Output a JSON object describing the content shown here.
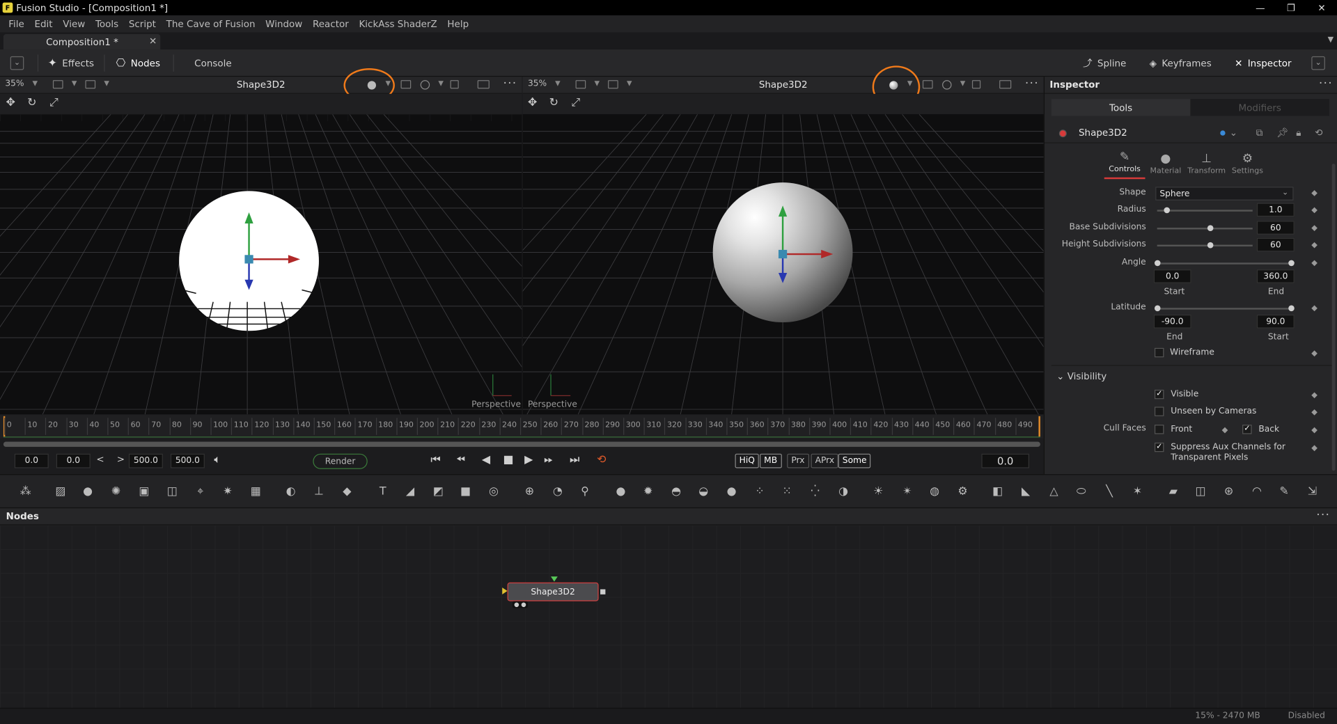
{
  "window": {
    "title": "Fusion Studio - [Composition1 *]",
    "controls": [
      "—",
      "❐",
      "✕"
    ]
  },
  "menu": [
    "File",
    "Edit",
    "View",
    "Tools",
    "Script",
    "The Cave of Fusion",
    "Window",
    "Reactor",
    "KickAss ShaderZ",
    "Help"
  ],
  "doc_tab": {
    "label": "Composition1 *",
    "close": "✕"
  },
  "toolbar": {
    "effects": "Effects",
    "nodes": "Nodes",
    "console": "Console",
    "spline": "Spline",
    "keyframes": "Keyframes",
    "inspector": "Inspector"
  },
  "viewer_left": {
    "zoom": "35%",
    "title": "Shape3D2",
    "label": "Perspective"
  },
  "viewer_right": {
    "zoom": "35%",
    "title": "Shape3D2",
    "label": "Perspective"
  },
  "ruler": {
    "ticks": [
      "0",
      "10",
      "20",
      "30",
      "40",
      "50",
      "60",
      "70",
      "80",
      "90",
      "100",
      "110",
      "120",
      "130",
      "140",
      "150",
      "160",
      "170",
      "180",
      "190",
      "200",
      "210",
      "220",
      "230",
      "240",
      "250",
      "260",
      "270",
      "280",
      "290",
      "300",
      "310",
      "320",
      "330",
      "340",
      "350",
      "360",
      "370",
      "380",
      "390",
      "400",
      "410",
      "420",
      "430",
      "440",
      "450",
      "460",
      "470",
      "480",
      "490"
    ]
  },
  "transport": {
    "global_start": "0.0",
    "render_start": "0.0",
    "render_end": "500.0",
    "global_end": "500.0",
    "render_label": "Render",
    "toggles": [
      "HiQ",
      "MB",
      "Prx",
      "APrx",
      "Some"
    ],
    "current_time": "0.0"
  },
  "nodes_panel": {
    "title": "Nodes",
    "node_label": "Shape3D2"
  },
  "status": {
    "memory": "15% - 2470 MB",
    "state": "Disabled"
  },
  "inspector": {
    "title": "Inspector",
    "seg_tools": "Tools",
    "seg_modifiers": "Modifiers",
    "tool_name": "Shape3D2",
    "subtabs": [
      "Controls",
      "Material",
      "Transform",
      "Settings"
    ],
    "shape_label": "Shape",
    "shape_value": "Sphere",
    "radius_label": "Radius",
    "radius_value": "1.0",
    "base_sub_label": "Base Subdivisions",
    "base_sub_value": "60",
    "height_sub_label": "Height Subdivisions",
    "height_sub_value": "60",
    "angle_label": "Angle",
    "angle_start": "0.0",
    "angle_end": "360.0",
    "cap_start": "Start",
    "cap_end": "End",
    "latitude_label": "Latitude",
    "lat_start": "-90.0",
    "lat_end": "90.0",
    "lat_cap_left": "End",
    "lat_cap_right": "Start",
    "wireframe": "Wireframe",
    "visibility": "Visibility",
    "visible": "Visible",
    "unseen": "Unseen by Cameras",
    "cull_faces": "Cull Faces",
    "front": "Front",
    "back": "Back",
    "suppress_1": "Suppress Aux Channels for",
    "suppress_2": "Transparent Pixels"
  },
  "colors": {
    "accent_red": "#d83a3a",
    "highlight_orange": "#f07a1a",
    "timeline_green": "#3a7a3a"
  }
}
